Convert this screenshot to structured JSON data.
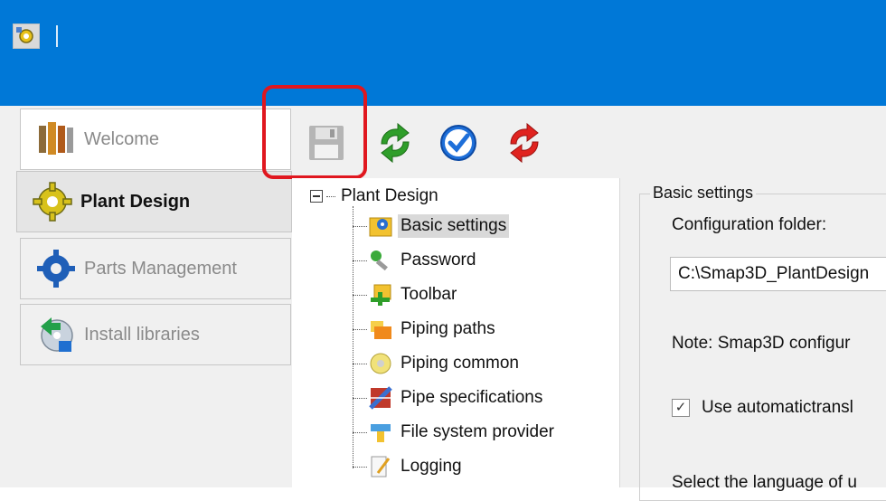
{
  "window": {
    "app_icon": "gear-app-icon"
  },
  "nav": {
    "tabs": [
      {
        "label": "Welcome",
        "icon": "people-icon"
      },
      {
        "label": "Plant Design",
        "icon": "gear-yellow-icon"
      },
      {
        "label": "Parts Management",
        "icon": "gear-blue-icon"
      },
      {
        "label": "Install libraries",
        "icon": "install-cd-icon"
      }
    ],
    "active": "Plant Design"
  },
  "toolbar": {
    "buttons": [
      "save-icon",
      "refresh-green-icon",
      "apply-check-icon",
      "reset-red-icon"
    ],
    "highlighted": "save-icon",
    "highlight_color": "#e0171f"
  },
  "tree": {
    "root_label": "Plant Design",
    "items": [
      {
        "label": "Basic settings",
        "icon": "basic-settings-icon"
      },
      {
        "label": "Password",
        "icon": "key-icon"
      },
      {
        "label": "Toolbar",
        "icon": "toolbar-icon"
      },
      {
        "label": "Piping paths",
        "icon": "folder-icon"
      },
      {
        "label": "Piping common",
        "icon": "piping-common-icon"
      },
      {
        "label": "Pipe specifications",
        "icon": "pipe-spec-icon"
      },
      {
        "label": "File system provider",
        "icon": "file-system-icon"
      },
      {
        "label": "Logging",
        "icon": "log-icon"
      }
    ],
    "selected": "Basic settings"
  },
  "settings": {
    "group_title": "Basic settings",
    "config_folder_label": "Configuration folder:",
    "config_folder_value": "C:\\Smap3D_PlantDesign",
    "note": "Note: Smap3D configur",
    "auto_translate_label": "Use automatictransl",
    "auto_translate_checked": true,
    "language_label": "Select the language of u"
  },
  "colors": {
    "titlebar": "#0078d7",
    "panel": "#f0f0f0",
    "selection": "#d9d9d9"
  }
}
